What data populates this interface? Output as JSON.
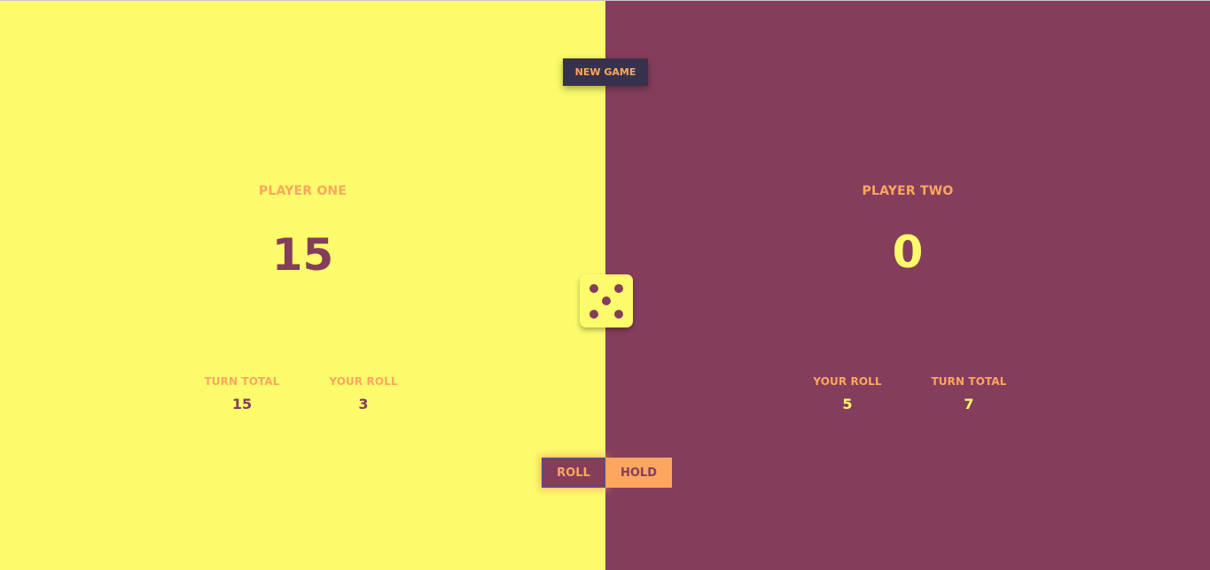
{
  "controls": {
    "new_game_label": "NEW GAME",
    "roll_label": "ROLL",
    "hold_label": "HOLD"
  },
  "player_one": {
    "name": "PLAYER ONE",
    "score": "15",
    "turn_total_label": "TURN TOTAL",
    "turn_total_value": "15",
    "your_roll_label": "YOUR ROLL",
    "your_roll_value": "3"
  },
  "player_two": {
    "name": "PLAYER TWO",
    "score": "0",
    "your_roll_label": "YOUR ROLL",
    "your_roll_value": "5",
    "turn_total_label": "TURN TOTAL",
    "turn_total_value": "7"
  },
  "dice": {
    "face_value": 5,
    "icon": "die-five-icon"
  },
  "colors": {
    "player_one_bg": "#fbfb6c",
    "player_two_bg": "#843e5b",
    "accent": "#fda65f",
    "new_game_bg": "#37324b"
  }
}
